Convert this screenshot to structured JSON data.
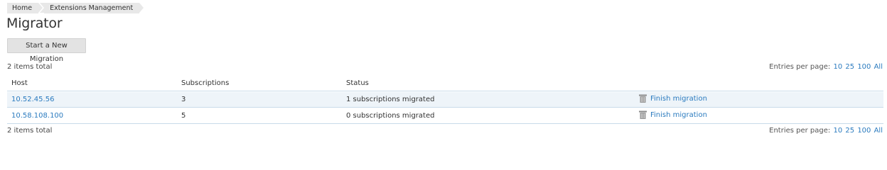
{
  "breadcrumb": {
    "items": [
      {
        "label": "Home"
      },
      {
        "label": "Extensions Management"
      }
    ]
  },
  "page": {
    "title": "Migrator",
    "new_migration_label": "Start a New Migration"
  },
  "summary": {
    "items_total_top": "2 items total",
    "items_total_bottom": "2 items total"
  },
  "pagination": {
    "label": "Entries per page:",
    "options": [
      "10",
      "25",
      "100",
      "All"
    ]
  },
  "table": {
    "columns": [
      "Host",
      "Subscriptions",
      "Status"
    ],
    "rows": [
      {
        "host": "10.52.45.56",
        "subscriptions": "3",
        "status": "1 subscriptions migrated",
        "action": "Finish migration",
        "action_icon": "trash-icon"
      },
      {
        "host": "10.58.108.100",
        "subscriptions": "5",
        "status": "0 subscriptions migrated",
        "action": "Finish migration",
        "action_icon": "trash-icon"
      }
    ]
  },
  "colors": {
    "link": "#2b7bbf",
    "row_highlight": "#eef4f9",
    "button_bg": "#e3e3e3"
  }
}
